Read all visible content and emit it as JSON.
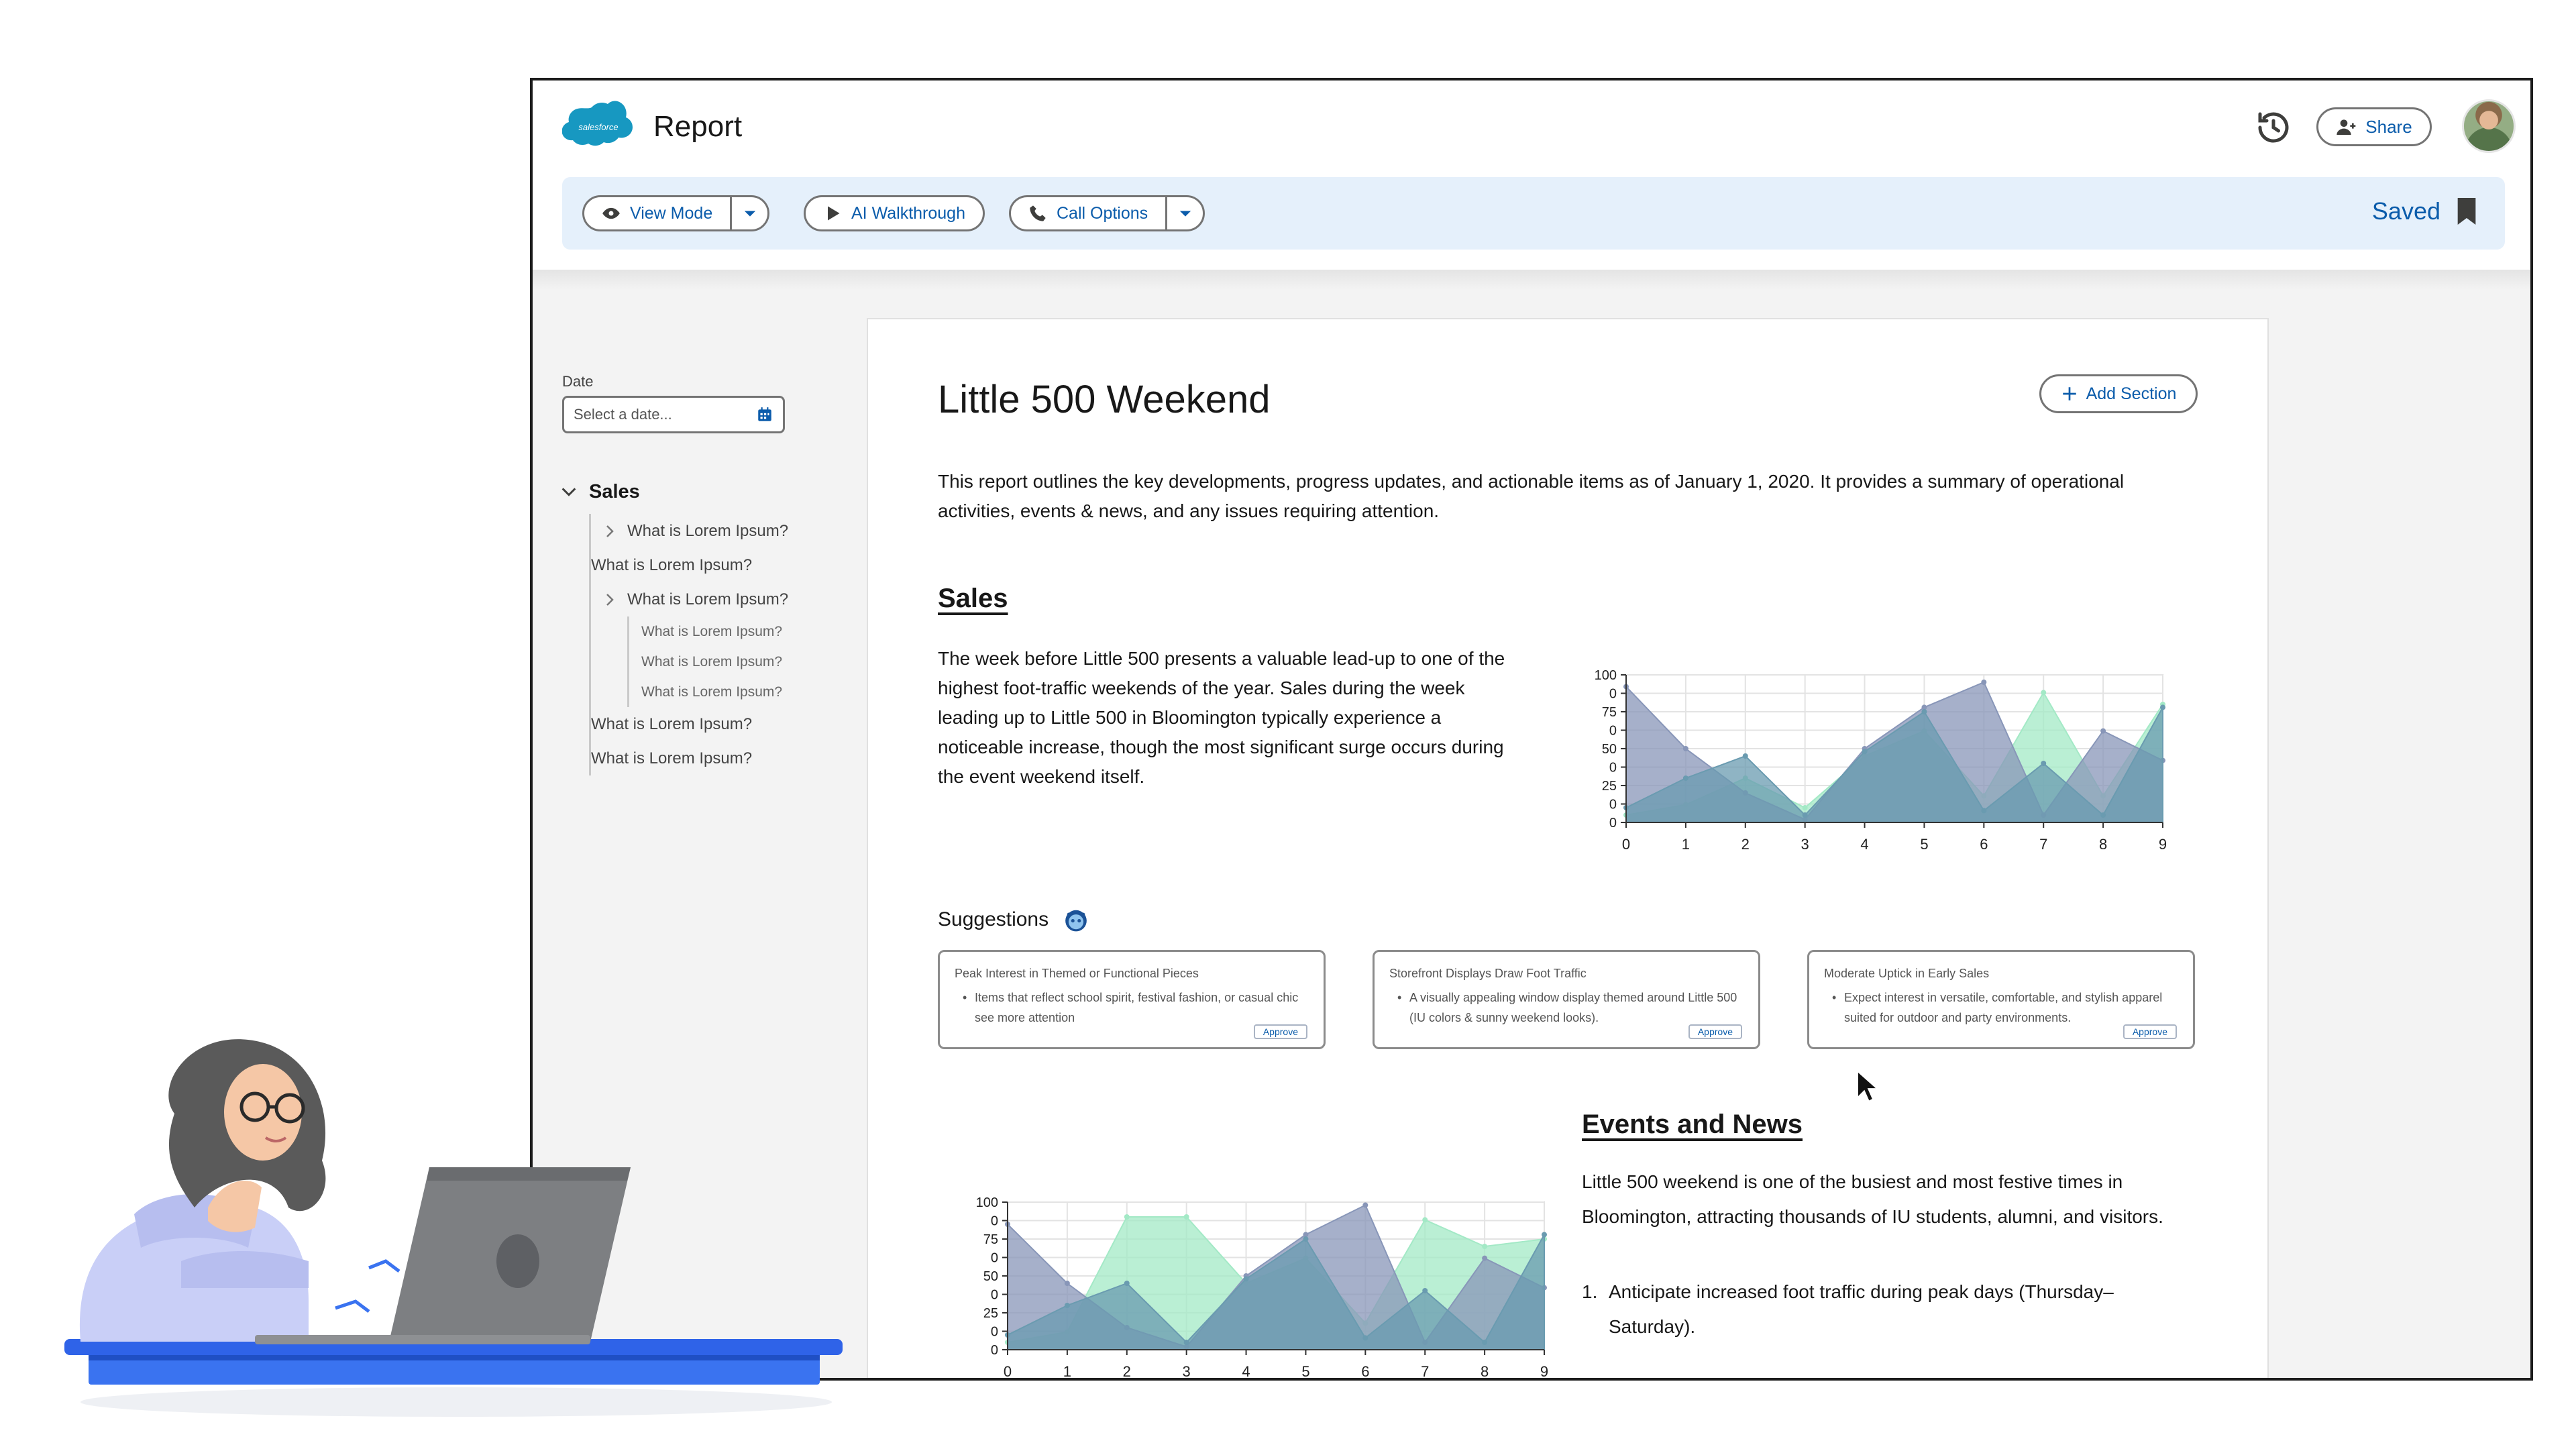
{
  "app": {
    "title": "Report",
    "logo_text": "salesforce"
  },
  "header": {
    "share_label": "Share"
  },
  "toolbar": {
    "view_mode_label": "View Mode",
    "ai_walkthrough_label": "AI Walkthrough",
    "call_options_label": "Call Options",
    "saved_label": "Saved"
  },
  "sidebar": {
    "date_label": "Date",
    "date_placeholder": "Select a date...",
    "sales_label": "Sales",
    "items": [
      {
        "label": "What is Lorem Ipsum?",
        "expandable": true
      },
      {
        "label": "What is Lorem Ipsum?",
        "expandable": false
      },
      {
        "label": "What is Lorem Ipsum?",
        "expandable": true
      },
      {
        "label": "What is Lorem Ipsum?",
        "expandable": false
      },
      {
        "label": "What is Lorem Ipsum?",
        "expandable": false
      }
    ],
    "sub_items": [
      "What is Lorem Ipsum?",
      "What is Lorem Ipsum?",
      "What is Lorem Ipsum?"
    ]
  },
  "report": {
    "title": "Little 500 Weekend",
    "add_section_label": "Add Section",
    "intro": "This report outlines the key developments, progress updates, and actionable items as of January 1, 2020. It provides a summary of operational activities, events & news, and any issues requiring attention.",
    "sales_heading": "Sales",
    "sales_text": "The week before Little 500 presents a valuable lead-up to one of the highest foot-traffic weekends of the year. Sales during the week leading up to Little 500 in Bloomington typically experience a noticeable increase, though the most significant surge occurs during the event weekend itself.",
    "suggestions_heading": "Suggestions",
    "suggestions": [
      {
        "title": "Peak Interest in Themed or Functional Pieces",
        "body": "Items that reflect school spirit, festival fashion, or casual chic see more attention",
        "approve_label": "Approve"
      },
      {
        "title": "Storefront Displays Draw Foot Traffic",
        "body": "A visually appealing window display themed around Little 500 (IU colors & sunny weekend looks).",
        "approve_label": "Approve"
      },
      {
        "title": "Moderate Uptick in Early Sales",
        "body": "Expect interest in versatile, comfortable, and stylish apparel suited for outdoor and party environments.",
        "approve_label": "Approve"
      }
    ],
    "events_heading": "Events and News",
    "events_text": "Little 500 weekend is one of the busiest and most festive times in Bloomington, attracting thousands of IU students, alumni, and visitors.",
    "events_list": [
      {
        "num": "1.",
        "text": "Anticipate increased foot traffic during peak days (Thursday–Saturday)."
      }
    ]
  },
  "chart_data": [
    {
      "type": "area",
      "x": [
        0,
        1,
        2,
        3,
        4,
        5,
        6,
        7,
        8,
        9
      ],
      "y_tick_labels": [
        "100",
        "0",
        "75",
        "0",
        "50",
        "0",
        "25",
        "0",
        "0"
      ],
      "ylim": [
        0,
        100
      ],
      "grid": true,
      "series": [
        {
          "values": [
            5,
            12,
            30,
            10,
            45,
            62,
            18,
            88,
            18,
            80
          ],
          "color": "#a3e9c6"
        },
        {
          "values": [
            92,
            50,
            20,
            2,
            50,
            78,
            95,
            5,
            62,
            42
          ],
          "color": "#8896b8"
        },
        {
          "values": [
            10,
            30,
            45,
            5,
            48,
            75,
            8,
            40,
            5,
            78
          ],
          "color": "#6a9bb0"
        }
      ]
    },
    {
      "type": "area",
      "x": [
        0,
        1,
        2,
        3,
        4,
        5,
        6,
        7,
        8,
        9
      ],
      "y_tick_labels": [
        "100",
        "0",
        "75",
        "0",
        "50",
        "0",
        "25",
        "0",
        "0"
      ],
      "ylim": [
        0,
        100
      ],
      "grid": true,
      "series": [
        {
          "values": [
            5,
            12,
            90,
            90,
            45,
            62,
            18,
            88,
            70,
            75
          ],
          "color": "#a3e9c6"
        },
        {
          "values": [
            85,
            45,
            15,
            2,
            50,
            78,
            98,
            5,
            62,
            42
          ],
          "color": "#8896b8"
        },
        {
          "values": [
            10,
            30,
            45,
            5,
            48,
            75,
            8,
            40,
            5,
            78
          ],
          "color": "#6a9bb0"
        }
      ]
    }
  ],
  "colors": {
    "accent": "#0b5cab",
    "toolbar_bg": "#e5f0fb",
    "salesforce_blue": "#1798c1"
  }
}
